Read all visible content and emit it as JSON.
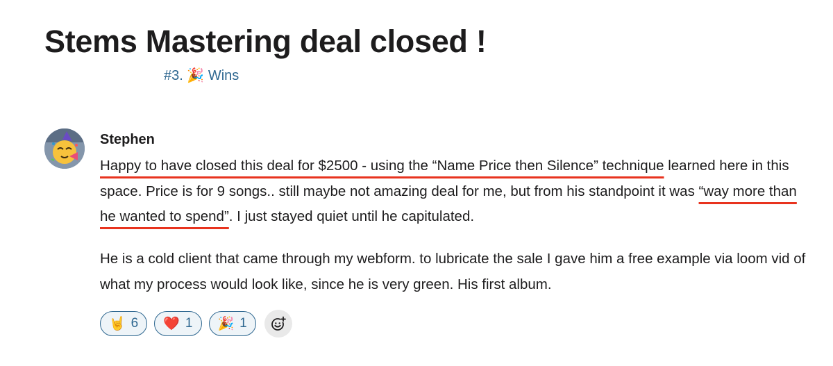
{
  "post": {
    "title": "Stems Mastering deal closed !",
    "channel": "#3. 🎉 Wins"
  },
  "message": {
    "author": "Stephen",
    "avatar_icon": "party-face-emoji",
    "para1": {
      "hl1": "Happy to have closed this deal for $2500 - using the “Name Price then Silence” technique",
      "mid": " learned here in this space. Price is for 9 songs.. still maybe not amazing deal for me, but from his standpoint it was ",
      "hl2": "“way more than he wanted to spend”",
      "end": ". I just stayed quiet until he capitulated."
    },
    "para2": "He is a cold client that came through my webform. to lubricate the sale I gave him a free example via loom vid of what my process would look like, since he is very green. His first album.",
    "highlight_color": "#e8331e"
  },
  "reactions": [
    {
      "emoji": "🤘",
      "icon": "rock-on-hand-icon",
      "count": "6"
    },
    {
      "emoji": "❤️",
      "icon": "red-heart-icon",
      "count": "1"
    },
    {
      "emoji": "🎉",
      "icon": "party-popper-icon",
      "count": "1"
    }
  ],
  "add_reaction_icon": "add-emoji-icon",
  "colors": {
    "text": "#1d1c1d",
    "link": "#2e6790",
    "reaction_bg": "#eef4f8",
    "underline": "#e8331e"
  }
}
